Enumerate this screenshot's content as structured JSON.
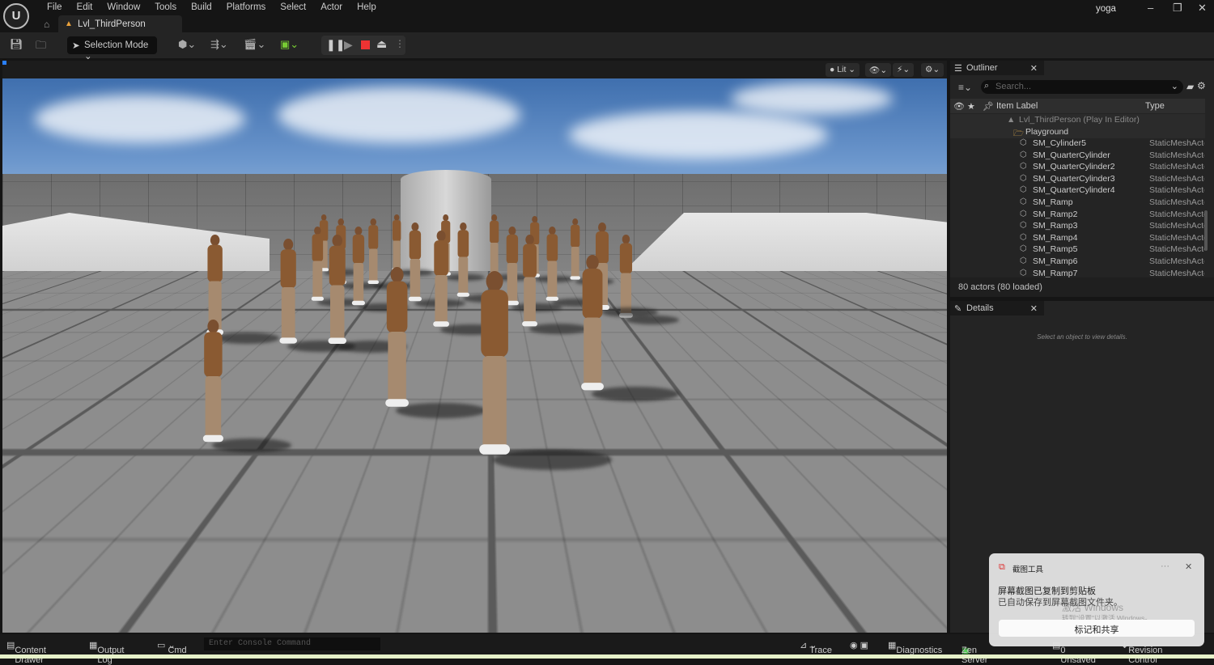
{
  "app": {
    "logo": "U",
    "user": "yoga",
    "menu": [
      "File",
      "Edit",
      "Window",
      "Tools",
      "Build",
      "Platforms",
      "Select",
      "Actor",
      "Help"
    ],
    "tab": "Lvl_ThirdPerson"
  },
  "toolbar": {
    "selection_mode": "Selection Mode"
  },
  "viewport": {
    "lit": "Lit"
  },
  "outliner": {
    "title": "Outliner",
    "search_placeholder": "Search...",
    "col_label": "Item Label",
    "col_type": "Type",
    "level": "Lvl_ThirdPerson (Play In Editor)",
    "folder": "Playground",
    "items": [
      {
        "label": "SM_Cylinder5",
        "type": "StaticMeshActor"
      },
      {
        "label": "SM_QuarterCylinder",
        "type": "StaticMeshActor"
      },
      {
        "label": "SM_QuarterCylinder2",
        "type": "StaticMeshActor"
      },
      {
        "label": "SM_QuarterCylinder3",
        "type": "StaticMeshActor"
      },
      {
        "label": "SM_QuarterCylinder4",
        "type": "StaticMeshActor"
      },
      {
        "label": "SM_Ramp",
        "type": "StaticMeshActor"
      },
      {
        "label": "SM_Ramp2",
        "type": "StaticMeshActor"
      },
      {
        "label": "SM_Ramp3",
        "type": "StaticMeshActor"
      },
      {
        "label": "SM_Ramp4",
        "type": "StaticMeshActor"
      },
      {
        "label": "SM_Ramp5",
        "type": "StaticMeshActor"
      },
      {
        "label": "SM_Ramp6",
        "type": "StaticMeshActor"
      },
      {
        "label": "SM_Ramp7",
        "type": "StaticMeshActor"
      }
    ],
    "count": "80 actors (80 loaded)"
  },
  "details": {
    "title": "Details",
    "empty": "Select an object to view details."
  },
  "status": {
    "content_drawer": "Content Drawer",
    "output_log": "Output Log",
    "cmd": "Cmd",
    "console_placeholder": "Enter Console Command",
    "trace": "Trace",
    "diagnostics": "Diagnostics",
    "zen": "Zen Server",
    "unsaved": "0 Unsaved",
    "revision": "Revision Control"
  },
  "toast": {
    "app": "截图工具",
    "line1": "屏幕截图已复制到剪贴板",
    "line2": "已自动保存到屏幕截图文件夹。",
    "button": "标记和共享",
    "more": "···",
    "watermark1": "激活 Windows",
    "watermark2": "转到\"设置\"以激活 Windows。"
  }
}
